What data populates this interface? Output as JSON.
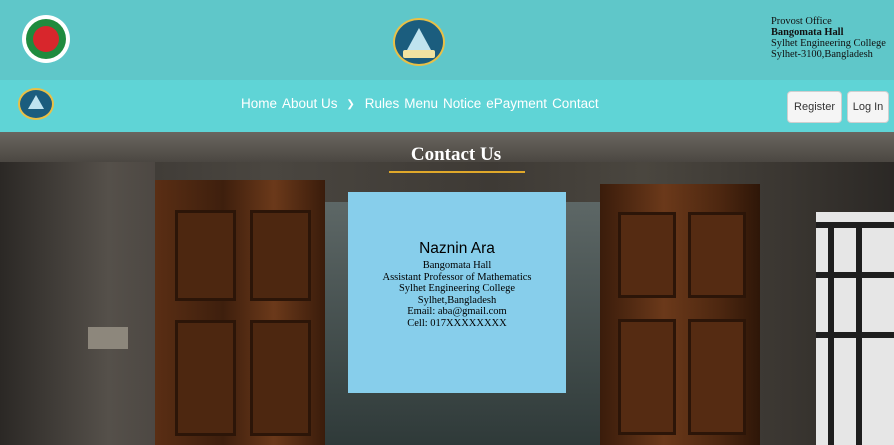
{
  "header": {
    "office_lines": [
      "Provost Office",
      "Bangomata Hall",
      "Sylhet Engineering College",
      "Sylhet-3100,Bangladesh"
    ],
    "icons": [
      "government-emblem-icon",
      "hall-logo-icon"
    ]
  },
  "nav": {
    "links": [
      {
        "label": "Home"
      },
      {
        "label": "About Us",
        "dropdown": true
      },
      {
        "label": "Rules"
      },
      {
        "label": "Menu"
      },
      {
        "label": "Notice"
      },
      {
        "label": "ePayment"
      },
      {
        "label": "Contact"
      }
    ],
    "register_label": "Register",
    "login_label": "Log In"
  },
  "contact": {
    "title": "Contact Us",
    "card": {
      "name": "Naznin Ara",
      "lines": [
        "Bangomata Hall",
        "Assistant Professor of Mathematics",
        "Sylhet Engineering College",
        "Sylhet,Bangladesh",
        "Email: aba@gmail.com",
        "Cell: 017XXXXXXXX"
      ]
    }
  },
  "colors": {
    "header_bg": "#5fc7c9",
    "nav_bg": "#5fd4d6",
    "card_bg": "#87ceeb",
    "accent": "#e0a82a"
  }
}
